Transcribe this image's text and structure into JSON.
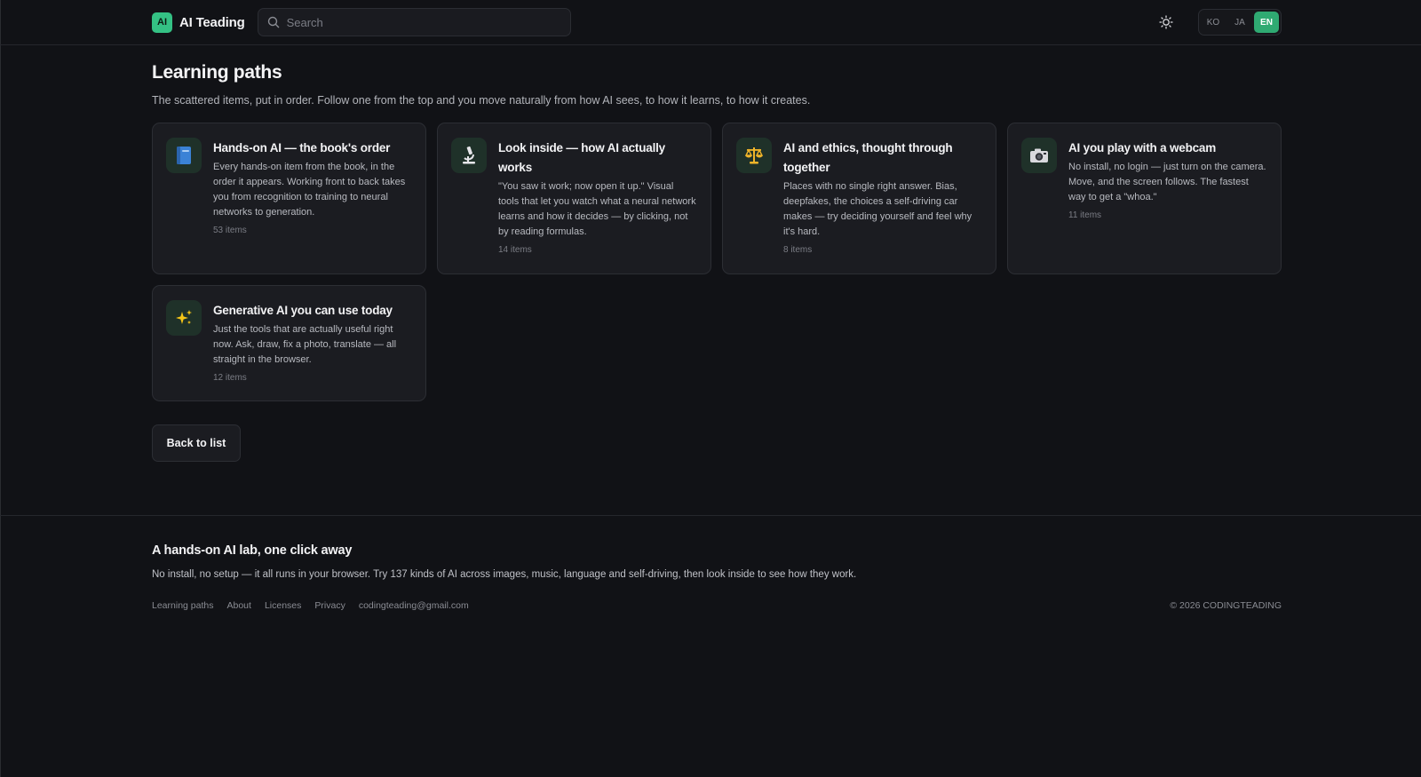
{
  "header": {
    "logo_badge": "AI",
    "logo_text": "AI Teading",
    "search_placeholder": "Search",
    "theme_icon": "sun-icon",
    "languages": [
      {
        "label": "KO",
        "active": false
      },
      {
        "label": "JA",
        "active": false
      },
      {
        "label": "EN",
        "active": true
      }
    ]
  },
  "main": {
    "title": "Learning paths",
    "subtitle": "The scattered items, put in order. Follow one from the top and you move naturally from how AI sees, to how it learns, to how it creates.",
    "cards": [
      {
        "icon": "book-icon",
        "emoji": "📘",
        "title": "Hands-on AI — the book's order",
        "description": "Every hands-on item from the book, in the order it appears. Working front to back takes you from recognition to training to neural networks to generation.",
        "count": "53 items"
      },
      {
        "icon": "microscope-icon",
        "emoji": "🔬",
        "title": "Look inside — how AI actually works",
        "description": "\"You saw it work; now open it up.\" Visual tools that let you watch what a neural network learns and how it decides — by clicking, not by reading formulas.",
        "count": "14 items"
      },
      {
        "icon": "scales-icon",
        "emoji": "⚖️",
        "title": "AI and ethics, thought through together",
        "description": "Places with no single right answer. Bias, deepfakes, the choices a self-driving car makes — try deciding yourself and feel why it's hard.",
        "count": "8 items"
      },
      {
        "icon": "camera-icon",
        "emoji": "📷",
        "title": "AI you play with a webcam",
        "description": "No install, no login — just turn on the camera. Move, and the screen follows. The fastest way to get a \"whoa.\"",
        "count": "11 items"
      },
      {
        "icon": "sparkles-icon",
        "emoji": "✨",
        "title": "Generative AI you can use today",
        "description": "Just the tools that are actually useful right now. Ask, draw, fix a photo, translate — all straight in the browser.",
        "count": "12 items"
      }
    ],
    "back_label": "Back to list"
  },
  "footer": {
    "title": "A hands-on AI lab, one click away",
    "subtitle": "No install, no setup — it all runs in your browser. Try 137 kinds of AI across images, music, language and self-driving, then look inside to see how they work.",
    "links": [
      "Learning paths",
      "About",
      "Licenses",
      "Privacy",
      "codingteading@gmail.com"
    ],
    "copyright": "© 2026 CODINGTEADING"
  },
  "colors": {
    "background": "#111216",
    "card": "#1b1c21",
    "accent": "#2faa72",
    "logo": "#34c184"
  }
}
